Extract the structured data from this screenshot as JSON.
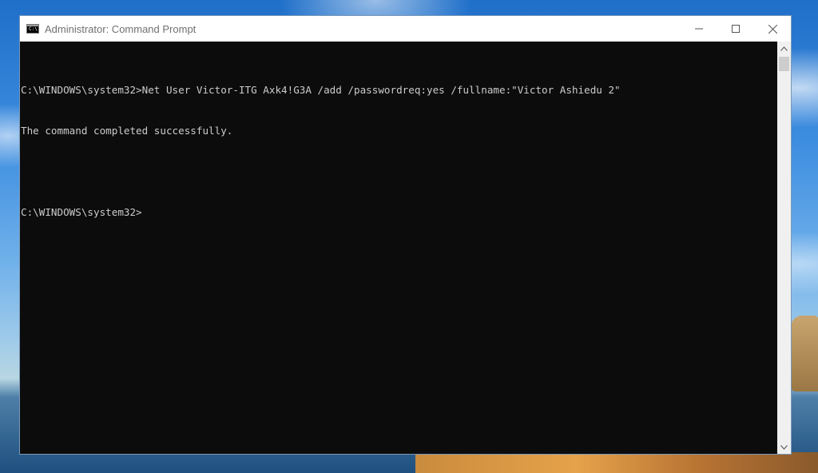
{
  "window": {
    "title": "Administrator: Command Prompt",
    "icon_label": "C:\\",
    "controls": [
      "minimize-icon",
      "maximize-icon",
      "close-icon"
    ]
  },
  "console": {
    "line1": "C:\\WINDOWS\\system32>Net User Victor-ITG Axk4!G3A /add /passwordreq:yes /fullname:\"Victor Ashiedu 2\"",
    "line2": "The command completed successfully.",
    "line3": "",
    "line4": "C:\\WINDOWS\\system32>"
  },
  "colors": {
    "console_bg": "#0c0c0c",
    "console_text": "#cccccc",
    "titlebar_bg": "#ffffff"
  }
}
